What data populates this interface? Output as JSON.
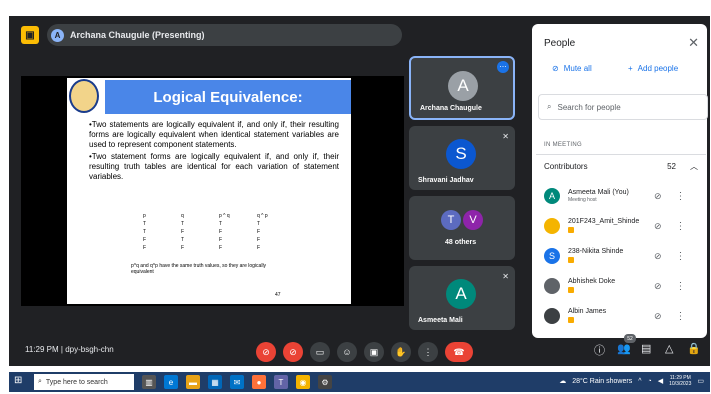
{
  "meeting": {
    "presenter_label": "Archana Chaugule (Presenting)",
    "presenter_initial": "A",
    "time": "11:29 PM",
    "separator": "|",
    "code": "dpy-bsgh-chn"
  },
  "slide": {
    "title": "Logical Equivalence:",
    "bullet1": "•Two statements are logically equivalent if, and only if, their resulting forms are logically equivalent when identical statement variables are used to represent component statements.",
    "bullet2": "•Two statement forms are logically equivalent if, and only if, their resulting truth tables are identical for each variation of statement variables.",
    "table_header": [
      "p",
      "q",
      "p ^ q",
      "q ^ p"
    ],
    "table_rows": [
      [
        "T",
        "T",
        "T",
        "T"
      ],
      [
        "T",
        "F",
        "F",
        "F"
      ],
      [
        "F",
        "T",
        "F",
        "F"
      ],
      [
        "F",
        "F",
        "F",
        "F"
      ]
    ],
    "note": "p^q and q^p have the same truth values, so they are logically equivalent",
    "page": "47"
  },
  "tiles": [
    {
      "name": "Archana Chaugule",
      "initial": "A",
      "color": "#9aa0a6"
    },
    {
      "name": "Shravani Jadhav",
      "initial": "S",
      "color": "#0b57d0"
    },
    {
      "name": "48 others",
      "initials": [
        "T",
        "V"
      ],
      "colors": [
        "#5c6bc0",
        "#8e24aa"
      ]
    },
    {
      "name": "Asmeeta Mali",
      "initial": "A",
      "color": "#00897b"
    }
  ],
  "panel": {
    "title": "People",
    "mute_all": "Mute all",
    "add_people": "Add people",
    "search_placeholder": "Search for people",
    "section": "IN MEETING",
    "group": "Contributors",
    "group_count": "52",
    "people": [
      {
        "name": "Asmeeta Mali (You)",
        "sub": "Meeting host",
        "initial": "A",
        "color": "#00897b"
      },
      {
        "name": "201F243_Amit_Shinde",
        "sub": "",
        "initial": "",
        "color": "#f4b400"
      },
      {
        "name": "238-Nikita Shinde",
        "sub": "",
        "initial": "S",
        "color": "#1a73e8"
      },
      {
        "name": "Abhishek Doke",
        "sub": "",
        "initial": "",
        "color": "#5f6368"
      },
      {
        "name": "Albin James",
        "sub": "",
        "initial": "",
        "color": "#3c4043"
      }
    ]
  },
  "controls": {
    "people_count": "52"
  },
  "taskbar": {
    "search_placeholder": "Type here to search",
    "weather": "28°C Rain showers",
    "clock_time": "11:29 PM",
    "clock_date": "10/3/2023"
  },
  "icons": {
    "present": "present-icon",
    "mic_off": "mic-off-icon",
    "cam_off": "camera-off-icon",
    "end": "end-call-icon"
  }
}
